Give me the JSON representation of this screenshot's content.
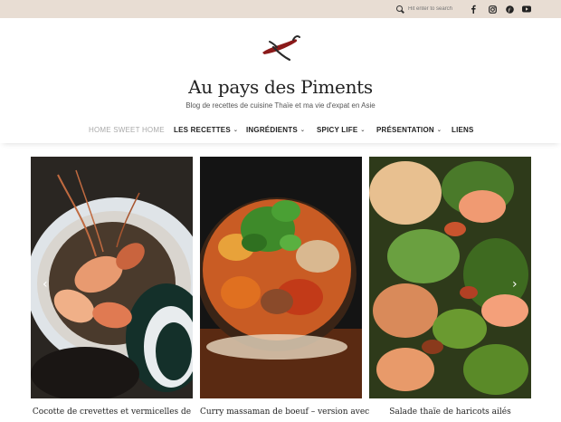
{
  "topbar": {
    "search": {
      "placeholder": "Hit enter to search"
    },
    "social": [
      "facebook-icon",
      "instagram-icon",
      "pinterest-icon",
      "youtube-icon"
    ]
  },
  "header": {
    "title": "Au pays des Piments",
    "tagline": "Blog de recettes de cuisine Thaïe et ma vie d'expat en Asie"
  },
  "nav": {
    "items": [
      {
        "label": "HOME SWEET HOME",
        "dropdown": false,
        "active": true
      },
      {
        "label": "LES RECETTES",
        "dropdown": true
      },
      {
        "label": "INGRÉDIENTS",
        "dropdown": true
      },
      {
        "label": "SPICY LIFE",
        "dropdown": true
      },
      {
        "label": "PRÉSENTATION",
        "dropdown": true
      },
      {
        "label": "LIENS",
        "dropdown": false
      }
    ],
    "caret": "⌄"
  },
  "slider": {
    "prev": "‹",
    "next": "›",
    "posts": [
      {
        "caption": "Cocotte de crevettes et vermicelles de"
      },
      {
        "caption": "Curry massaman de boeuf – version avec"
      },
      {
        "caption": "Salade thaïe de haricots ailés"
      }
    ]
  },
  "colors": {
    "topbar": "#e8ddd3",
    "accent": "#8b1a1a"
  }
}
